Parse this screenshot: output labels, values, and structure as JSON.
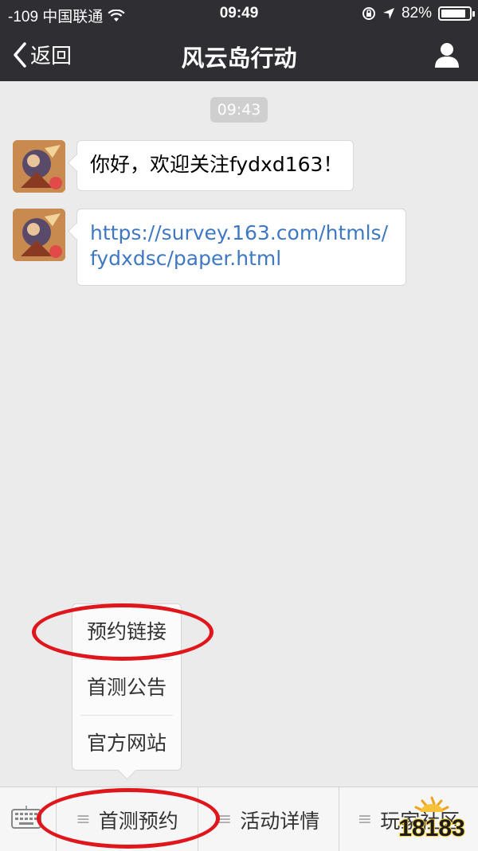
{
  "status_bar": {
    "carrier": "-109 中国联通",
    "time": "09:49",
    "battery": "82%"
  },
  "nav": {
    "back_label": "返回",
    "title": "风云岛行动"
  },
  "chat": {
    "timestamp": "09:43",
    "messages": [
      {
        "text": "你好，欢迎关注fydxd163！"
      },
      {
        "text": "https://survey.163.com/htmls/fydxdsc/paper.html"
      }
    ]
  },
  "popup_menu": {
    "items": [
      "预约链接",
      "首测公告",
      "官方网站"
    ]
  },
  "bottom_menu": {
    "items": [
      "首测预约",
      "活动详情",
      "玩家社区"
    ]
  },
  "colors": {
    "nav_bg": "#2e2e33",
    "link": "#3f78c2",
    "annotation": "#e0161d"
  },
  "watermark": "18183"
}
